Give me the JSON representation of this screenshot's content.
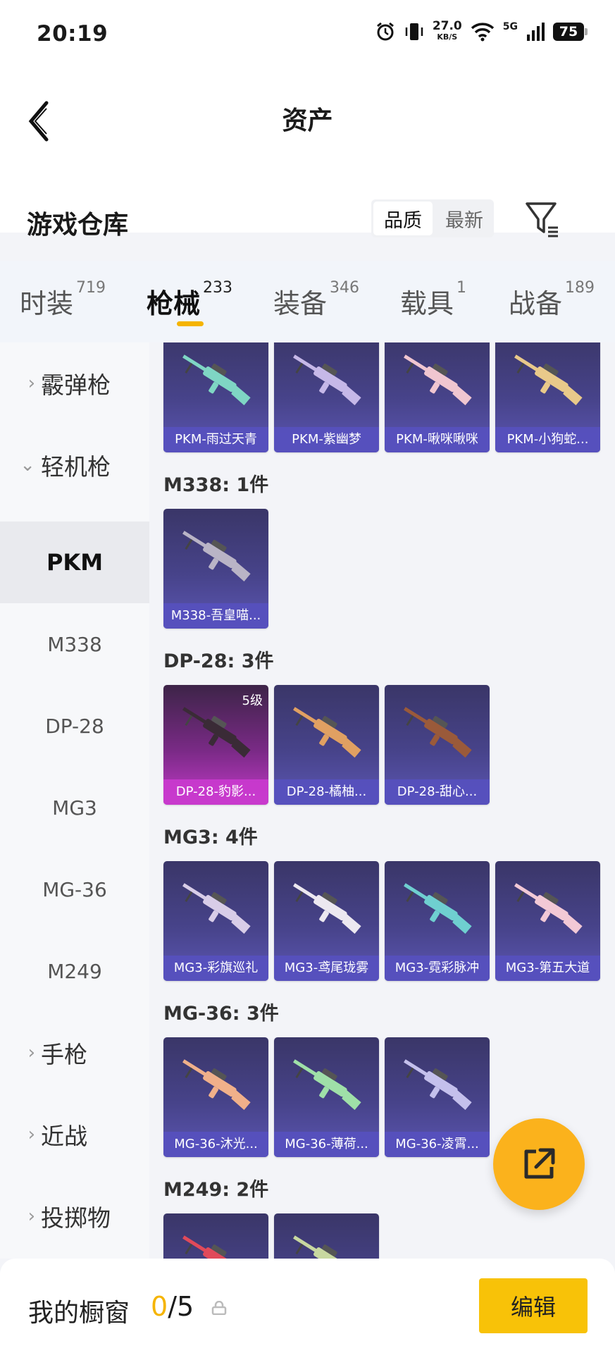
{
  "status": {
    "time": "20:19",
    "speed": "27.0",
    "speed_unit": "KB/S",
    "network": "5G",
    "battery": "75"
  },
  "header": {
    "title": "资产",
    "section_title": "游戏仓库",
    "sort_options": [
      "品质",
      "最新"
    ],
    "sort_active": "品质"
  },
  "tabs": [
    {
      "label": "时装",
      "count": "719"
    },
    {
      "label": "枪械",
      "count": "233"
    },
    {
      "label": "装备",
      "count": "346"
    },
    {
      "label": "载具",
      "count": "1"
    },
    {
      "label": "战备",
      "count": "189"
    }
  ],
  "sidebar": {
    "categories": [
      {
        "label": "霰弹枪"
      },
      {
        "label": "轻机枪"
      },
      {
        "label": "手枪"
      },
      {
        "label": "近战"
      },
      {
        "label": "投掷物"
      }
    ],
    "subitems": [
      "PKM",
      "M338",
      "DP-28",
      "MG3",
      "MG-36",
      "M249"
    ]
  },
  "groups": {
    "pkm": {
      "cards": [
        "PKM-雨过天青",
        "PKM-紫幽梦",
        "PKM-啾咪啾咪",
        "PKM-小狗蛇..."
      ]
    },
    "m338": {
      "label": "M338: 1件",
      "cards": [
        "M338-吾皇喵..."
      ]
    },
    "dp28": {
      "label": "DP-28: 3件",
      "cards": [
        "DP-28-豹影...",
        "DP-28-橘柚...",
        "DP-28-甜心..."
      ],
      "level": "5级"
    },
    "mg3": {
      "label": "MG3: 4件",
      "cards": [
        "MG3-彩旗巡礼",
        "MG3-鸢尾珑雾",
        "MG3-霓彩脉冲",
        "MG3-第五大道"
      ]
    },
    "mg36": {
      "label": "MG-36: 3件",
      "cards": [
        "MG-36-沐光...",
        "MG-36-薄荷...",
        "MG-36-凌霄..."
      ]
    },
    "m249": {
      "label": "M249: 2件"
    }
  },
  "gun_colors": {
    "pkm": [
      "#7fd6c4",
      "#c6b8e8",
      "#f0c6d0",
      "#e9c98a"
    ],
    "m338": [
      "#b9b4c6"
    ],
    "dp28": [
      "#3a2b36",
      "#e0a062",
      "#9a5a3a"
    ],
    "mg3": [
      "#d8cde8",
      "#ece8f0",
      "#6fcfd0",
      "#f2c9d6"
    ],
    "mg36": [
      "#f0b08a",
      "#9fe0a8",
      "#c4c0ec"
    ],
    "m249": [
      "#e04a5a",
      "#c8d8a0"
    ]
  },
  "bottom": {
    "label": "我的橱窗",
    "current": "0",
    "total": "/5",
    "edit": "编辑"
  }
}
